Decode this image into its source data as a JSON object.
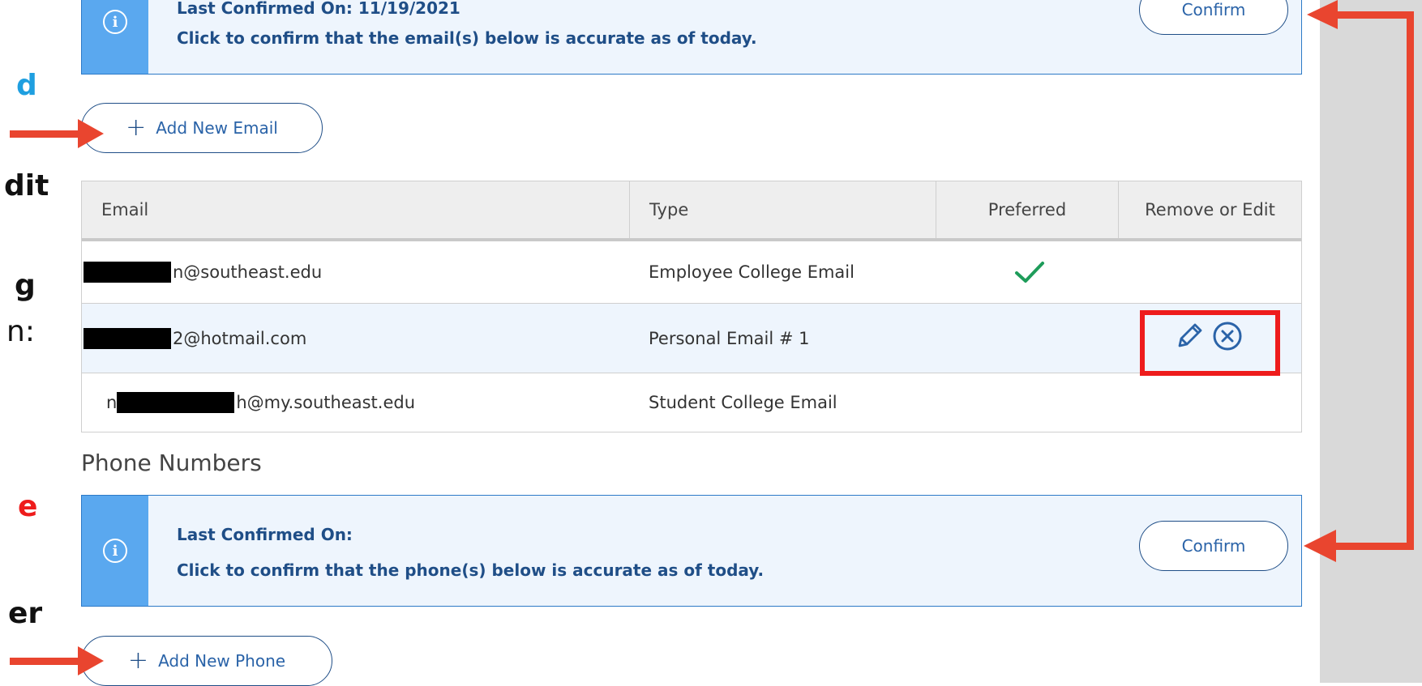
{
  "left_fragments": [
    {
      "text": "d",
      "color": "#1f9fe0"
    },
    {
      "text": "dit",
      "color": "#111111"
    },
    {
      "text": "g",
      "color": "#111111"
    },
    {
      "text": "n:",
      "color": "#111111"
    },
    {
      "text": "e",
      "color": "#ee1c1c"
    },
    {
      "text": "er",
      "color": "#111111"
    }
  ],
  "email_banner": {
    "title": "Last Confirmed On: 11/19/2021",
    "text": "Click to confirm that the email(s) below is accurate as of today.",
    "confirm_label": "Confirm"
  },
  "add_email_label": "Add New Email",
  "email_table": {
    "headers": [
      "Email",
      "Type",
      "Preferred",
      "Remove or Edit"
    ],
    "rows": [
      {
        "prefix": "",
        "email": "n@southeast.edu",
        "type": "Employee College Email",
        "preferred": true
      },
      {
        "prefix": "",
        "email": "2@hotmail.com",
        "type": "Personal Email # 1",
        "preferred": false
      },
      {
        "prefix": "n",
        "email": "h@my.southeast.edu",
        "type": "Student College Email",
        "preferred": false
      }
    ]
  },
  "phone_section_title": "Phone Numbers",
  "phone_banner": {
    "title": "Last Confirmed On:",
    "text": "Click to confirm that the phone(s) below is accurate as of today.",
    "confirm_label": "Confirm"
  },
  "add_phone_label": "Add New Phone",
  "colors": {
    "banner_bg": "#eef5fd",
    "banner_accent": "#5aa8ef",
    "link_blue": "#1f4e87",
    "arrow_red": "#e9452f",
    "highlight_red": "#ee1c1c",
    "check_green": "#1e9c5a",
    "sidebar_gray": "#d9d9d9"
  }
}
